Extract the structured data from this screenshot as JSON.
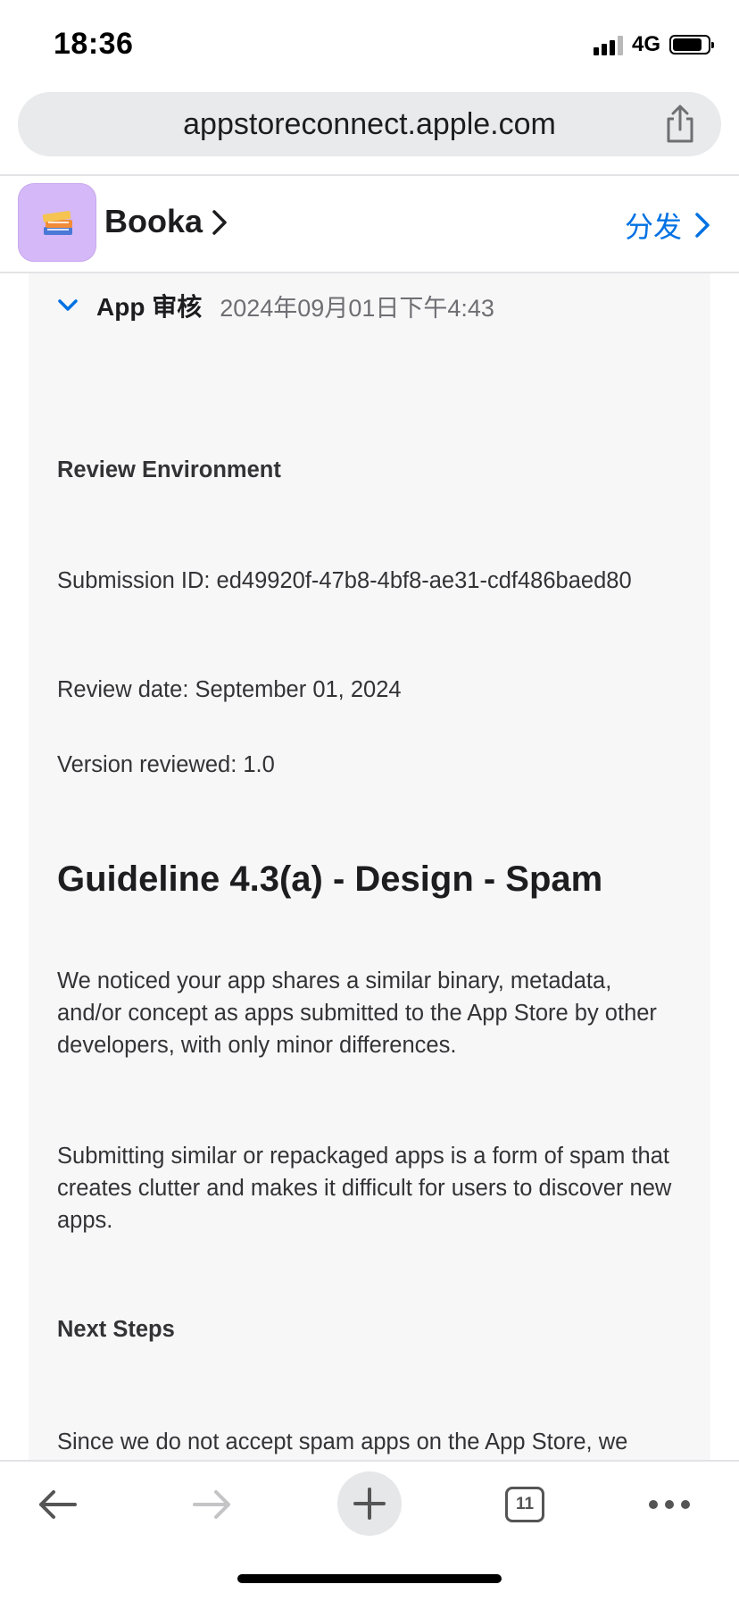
{
  "status_bar": {
    "time": "18:36",
    "network": "4G",
    "battery_level": 0.85
  },
  "browser": {
    "url": "appstoreconnect.apple.com",
    "tab_count": "11"
  },
  "app_header": {
    "app_name": "Booka",
    "distribute_label": "分发",
    "accent_color": "#0071e3"
  },
  "review": {
    "section_label": "App 审核",
    "date": "2024年09月01日下午4:43",
    "environment_heading": "Review Environment",
    "submission_id": "Submission ID: ed49920f-47b8-4bf8-ae31-cdf486baed80",
    "review_date": "Review date: September 01, 2024",
    "version_reviewed": "Version reviewed: 1.0",
    "guideline_heading": "Guideline 4.3(a) - Design - Spam",
    "paragraph_1": "We noticed your app shares a similar binary, metadata, and/or concept as apps submitted to the App Store by other developers, with only minor differences.",
    "paragraph_2": "Submitting similar or repackaged apps is a form of spam that creates clutter and makes it difficult for users to discover new apps.",
    "next_steps_heading": "Next Steps",
    "paragraph_3": "Since we do not accept spam apps on the App Store, we"
  },
  "icons": {
    "share": "share-icon",
    "back": "back-arrow-icon",
    "forward": "forward-arrow-icon",
    "add": "plus-icon",
    "tabs": "tabs-icon",
    "more": "more-icon",
    "expand": "chevron-down-icon"
  }
}
